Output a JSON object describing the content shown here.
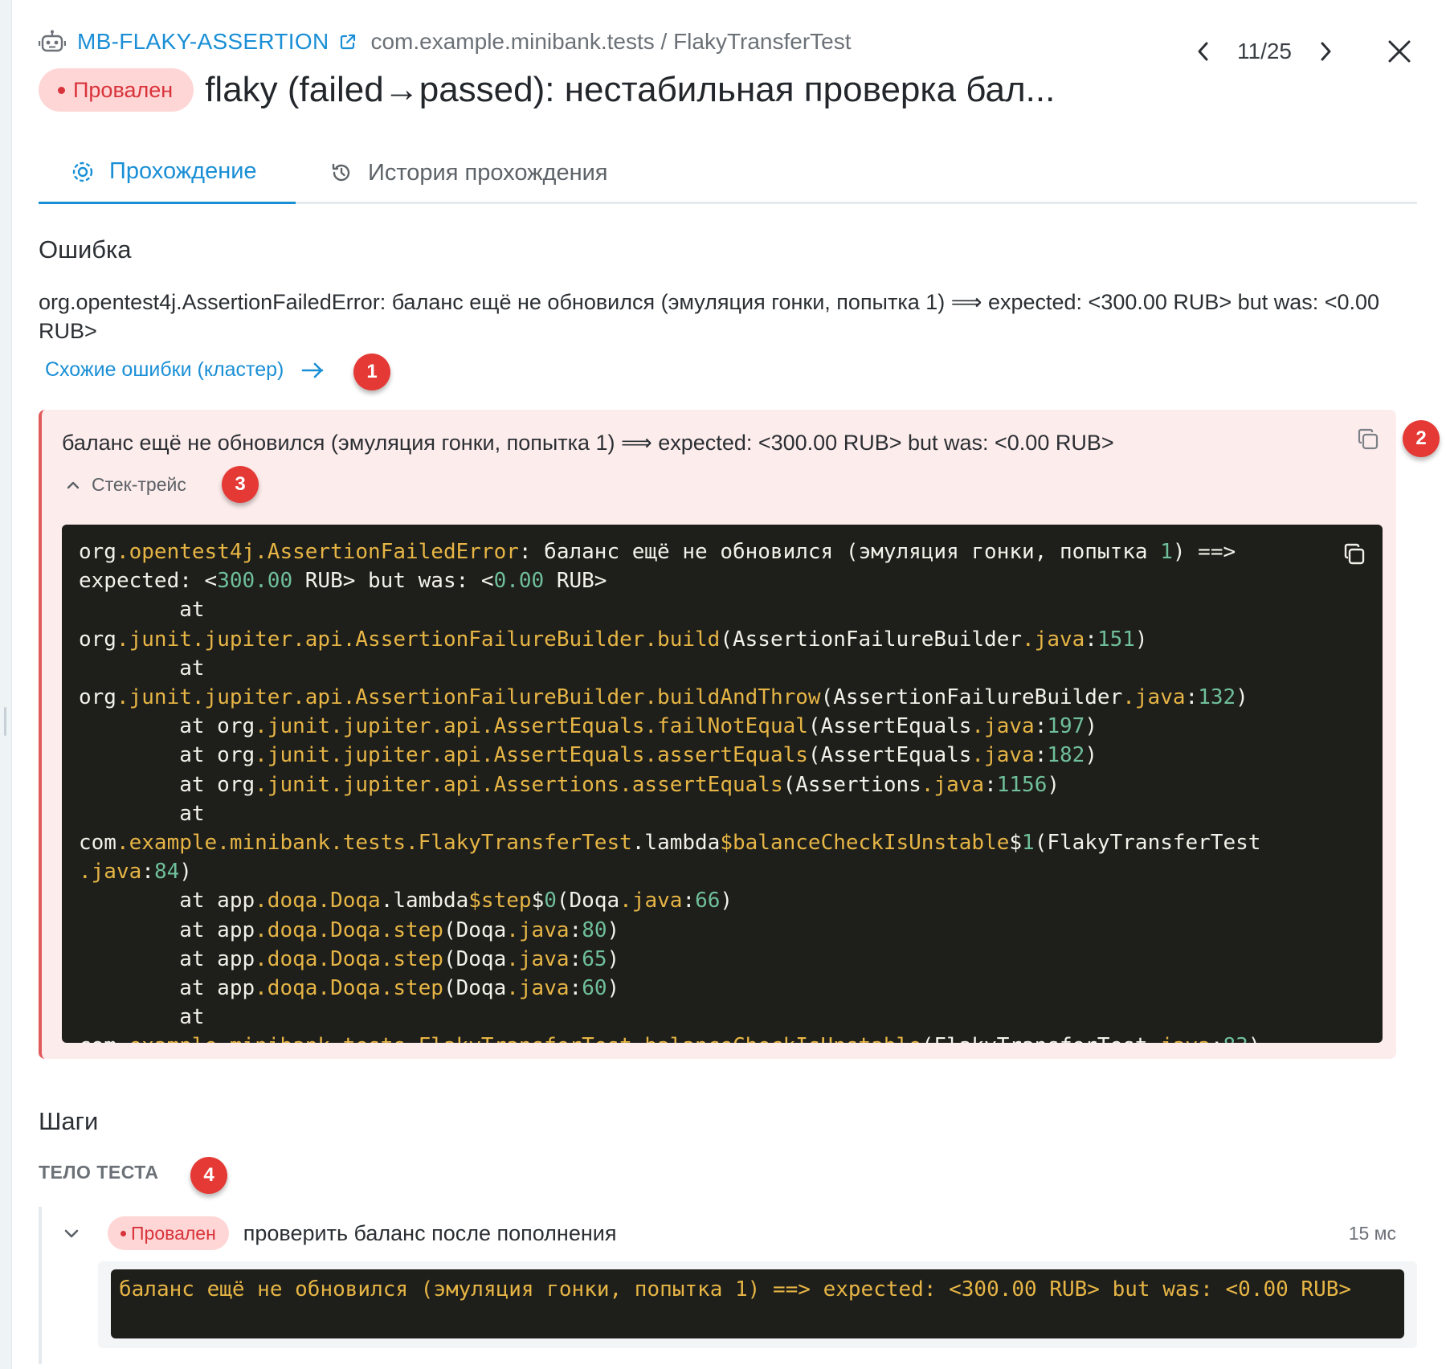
{
  "header": {
    "test_key": "MB-FLAKY-ASSERTION",
    "test_path": "com.example.minibank.tests / FlakyTransferTest",
    "status": "Провален",
    "title": "flaky (failed→passed): нестабильная проверка бал...",
    "counter": "11/25"
  },
  "tabs": [
    {
      "label": "Прохождение",
      "active": true
    },
    {
      "label": "История прохождения",
      "active": false
    }
  ],
  "error": {
    "section_title": "Ошибка",
    "summary": "org.opentest4j.AssertionFailedError: баланс ещё не обновился (эмуляция гонки, попытка 1) ⟹ expected: <300.00 RUB> but was: <0.00 RUB>",
    "cluster_link": "Схожие ошибки (кластер)",
    "message": "баланс ещё не обновился (эмуляция гонки, попытка 1) ⟹ expected: <300.00 RUB> but was: <0.00 RUB>",
    "stack_toggle": "Стек-трейс"
  },
  "badges": [
    "1",
    "2",
    "3",
    "4"
  ],
  "steps": {
    "section_title": "Шаги",
    "group_label": "ТЕЛО ТЕСТА",
    "items": [
      {
        "status": "Провален",
        "name": "проверить баланс после пополнения",
        "duration": "15 мс",
        "error": "баланс ещё не обновился (эмуляция гонки, попытка 1) ==> expected: <300.00 RUB> but was: <0.00 RUB>"
      }
    ]
  },
  "colors": {
    "accent": "#1a8fd6",
    "failed": "#d8333a",
    "failed_bg": "#ffd6d6",
    "error_box_bg": "#fdecec",
    "code_bg": "#1e1e1a",
    "badge": "#e53935"
  },
  "icons": [
    "robot-icon",
    "external-link-icon",
    "chevron-left-icon",
    "chevron-right-icon",
    "close-icon",
    "run-icon",
    "history-icon",
    "arrow-right-icon",
    "copy-icon",
    "chevron-up-icon",
    "chevron-down-icon"
  ]
}
